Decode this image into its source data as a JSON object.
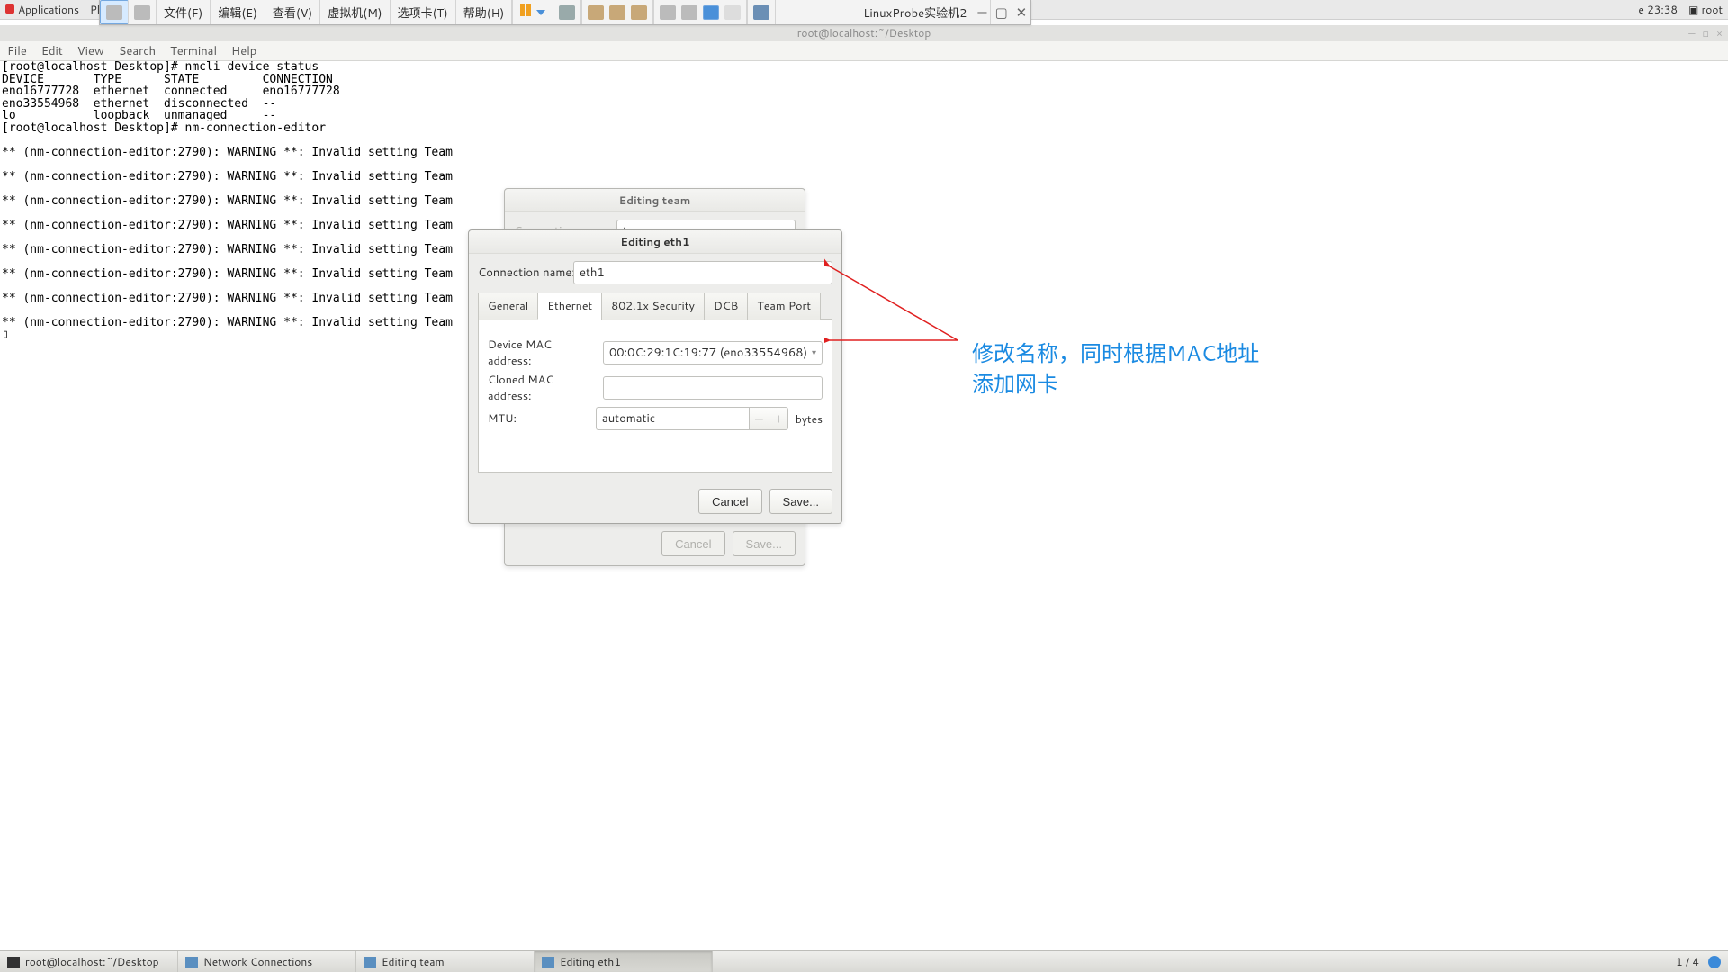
{
  "gnome": {
    "applications": "Applications",
    "places_short": "Pl",
    "time_right": "e 23:38",
    "user": "root"
  },
  "vmware": {
    "menus": [
      "文件(F)",
      "编辑(E)",
      "查看(V)",
      "虚拟机(M)",
      "选项卡(T)",
      "帮助(H)"
    ],
    "vm_title": "LinuxProbe实验机2"
  },
  "guest_window_title": "root@localhost:~/Desktop",
  "terminal_menu": [
    "File",
    "Edit",
    "View",
    "Search",
    "Terminal",
    "Help"
  ],
  "terminal_output": "[root@localhost Desktop]# nmcli device status\nDEVICE       TYPE      STATE         CONNECTION  \neno16777728  ethernet  connected     eno16777728 \neno33554968  ethernet  disconnected  --          \nlo           loopback  unmanaged     --          \n[root@localhost Desktop]# nm-connection-editor\n\n** (nm-connection-editor:2790): WARNING **: Invalid setting Team\n\n** (nm-connection-editor:2790): WARNING **: Invalid setting Team\n\n** (nm-connection-editor:2790): WARNING **: Invalid setting Team\n\n** (nm-connection-editor:2790): WARNING **: Invalid setting Team\n\n** (nm-connection-editor:2790): WARNING **: Invalid setting Team\n\n** (nm-connection-editor:2790): WARNING **: Invalid setting Team\n\n** (nm-connection-editor:2790): WARNING **: Invalid setting Team\n\n** (nm-connection-editor:2790): WARNING **: Invalid setting Team\n▯",
  "team_dialog": {
    "title": "Editing team",
    "conn_name_label": "Connection name:",
    "conn_name_value": "team",
    "cancel": "Cancel",
    "save": "Save..."
  },
  "eth_dialog": {
    "title": "Editing eth1",
    "conn_name_label": "Connection name:",
    "conn_name_value": "eth1",
    "tabs": {
      "general": "General",
      "ethernet": "Ethernet",
      "security": "802.1x Security",
      "dcb": "DCB",
      "teamport": "Team Port"
    },
    "fields": {
      "mac_label": "Device MAC address:",
      "mac_value": "00:0C:29:1C:19:77 (eno33554968)",
      "cloned_label": "Cloned MAC address:",
      "cloned_value": "",
      "mtu_label": "MTU:",
      "mtu_value": "automatic",
      "mtu_unit": "bytes"
    },
    "cancel": "Cancel",
    "save": "Save..."
  },
  "annotation": {
    "line1": "修改名称，同时根据MAC地址",
    "line2": "添加网卡"
  },
  "taskbar": {
    "items": [
      "root@localhost:~/Desktop",
      "Network Connections",
      "Editing team",
      "Editing eth1"
    ],
    "workspace": "1 / 4"
  }
}
